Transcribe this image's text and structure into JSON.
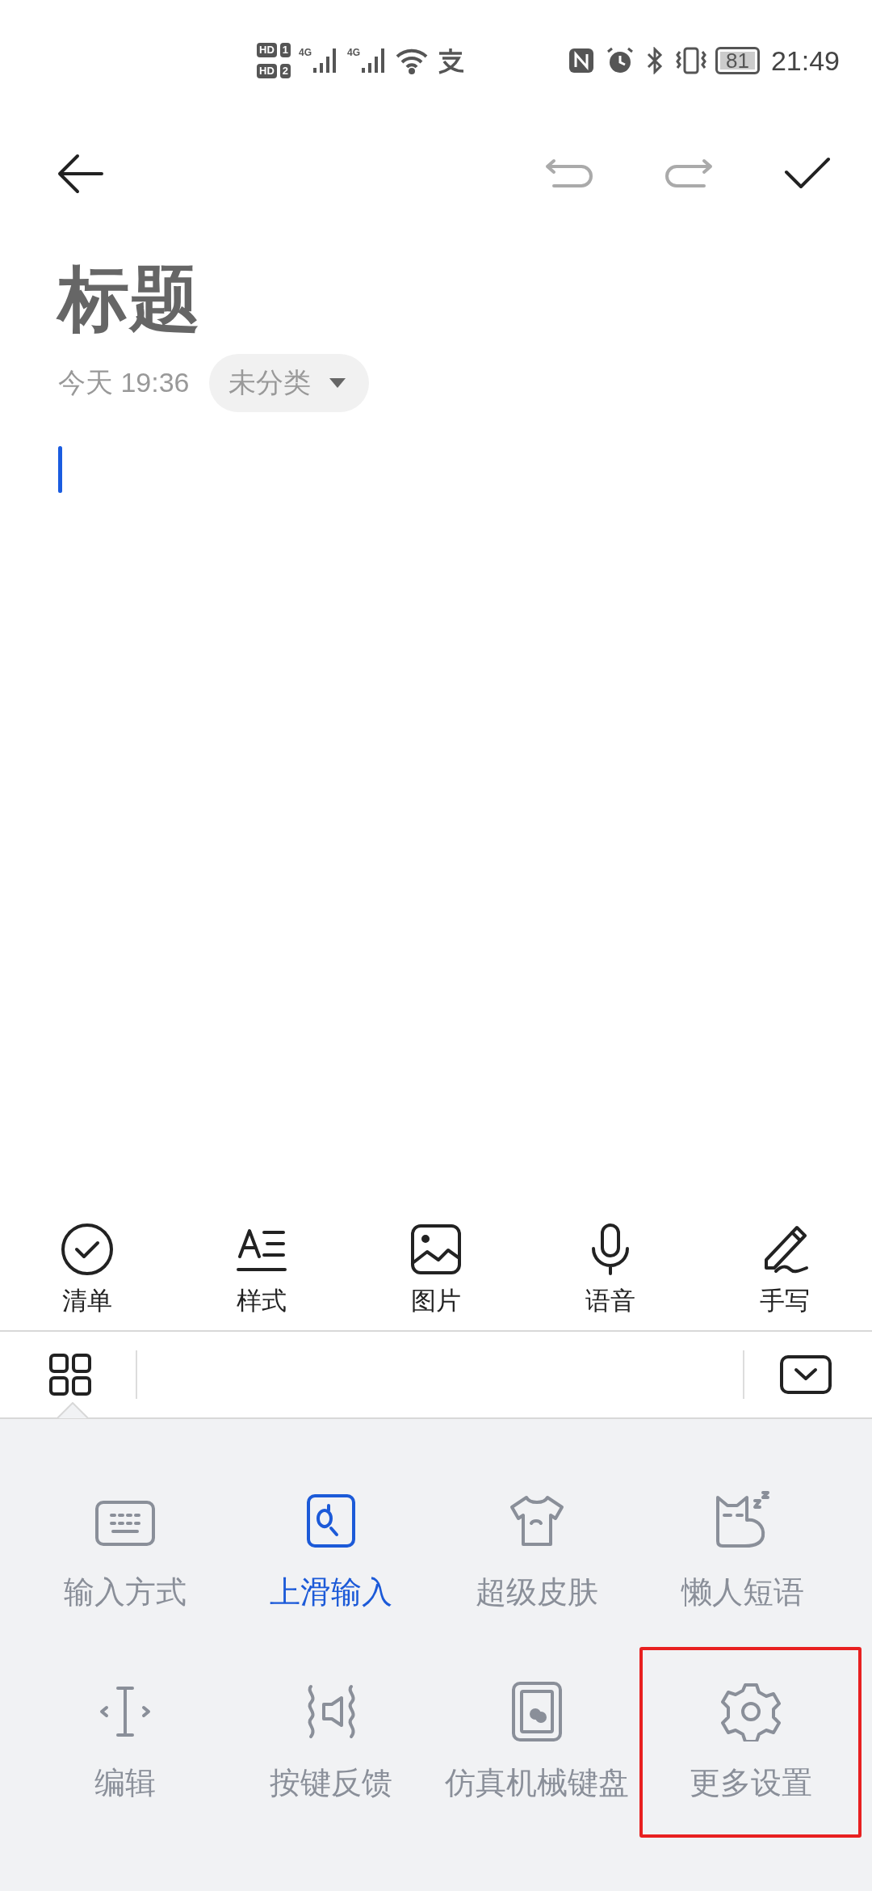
{
  "status_bar": {
    "sim_badges": [
      {
        "label": "HD",
        "slot": "1"
      },
      {
        "label": "HD",
        "slot": "2"
      }
    ],
    "networks": [
      "4G",
      "4G"
    ],
    "battery": "81",
    "time": "21:49"
  },
  "header": {
    "actions": [
      {
        "kind": "back",
        "disabled": false
      },
      {
        "kind": "undo",
        "disabled": true
      },
      {
        "kind": "redo",
        "disabled": true
      },
      {
        "kind": "confirm",
        "disabled": false
      }
    ]
  },
  "note": {
    "title": "标题",
    "date": "今天 19:36",
    "category": "未分类"
  },
  "toolbar": [
    {
      "kind": "checklist",
      "label": "清单"
    },
    {
      "kind": "style",
      "label": "样式"
    },
    {
      "kind": "image",
      "label": "图片"
    },
    {
      "kind": "voice",
      "label": "语音"
    },
    {
      "kind": "handwrite",
      "label": "手写"
    }
  ],
  "keyboard_bar": {
    "menu_selected": true
  },
  "panel": [
    {
      "kind": "keyboard",
      "label": "输入方式",
      "selected": false,
      "highlighted": false
    },
    {
      "kind": "swipe",
      "label": "上滑输入",
      "selected": true,
      "highlighted": false
    },
    {
      "kind": "skin",
      "label": "超级皮肤",
      "selected": false,
      "highlighted": false
    },
    {
      "kind": "phrases",
      "label": "懒人短语",
      "selected": false,
      "highlighted": false
    },
    {
      "kind": "edit",
      "label": "编辑",
      "selected": false,
      "highlighted": false
    },
    {
      "kind": "feedback",
      "label": "按键反馈",
      "selected": false,
      "highlighted": false
    },
    {
      "kind": "mechanical",
      "label": "仿真机械键盘",
      "selected": false,
      "highlighted": false
    },
    {
      "kind": "settings",
      "label": "更多设置",
      "selected": false,
      "highlighted": true
    }
  ]
}
